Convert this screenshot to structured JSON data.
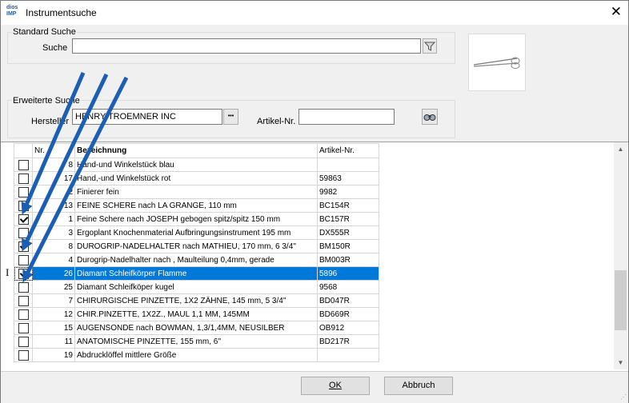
{
  "window": {
    "logo_top": "dios",
    "logo_bottom": "IMP",
    "title": "Instrumentsuche",
    "close_glyph": "✕"
  },
  "standard_search": {
    "legend": "Standard Suche",
    "label": "Suche",
    "value": "",
    "filter_icon": "filter-icon"
  },
  "extended_search": {
    "legend": "Erweiterte Suche",
    "hersteller_label": "Hersteller",
    "hersteller_value": "HENRY TROEMNER INC",
    "browse_label": "•••",
    "artikel_label": "Artikel-Nr.",
    "artikel_value": "",
    "search_icon": "binoculars-icon"
  },
  "table": {
    "columns": [
      "",
      "Nr.",
      "Bezeichnung",
      "Artikel-Nr."
    ],
    "rows": [
      {
        "checked": false,
        "nr": "8",
        "bezeichnung": "Hand-und Winkelstück blau",
        "artikel": "",
        "selected": false
      },
      {
        "checked": false,
        "nr": "17",
        "bezeichnung": "Hand,-und Winkelstück rot",
        "artikel": "59863",
        "selected": false
      },
      {
        "checked": false,
        "nr": "2",
        "bezeichnung": "Finierer fein",
        "artikel": "9982",
        "selected": false
      },
      {
        "checked": false,
        "nr": "13",
        "bezeichnung": "FEINE SCHERE nach LA GRANGE, 110 mm",
        "artikel": "BC154R",
        "selected": false
      },
      {
        "checked": true,
        "nr": "1",
        "bezeichnung": "Feine Schere nach JOSEPH gebogen spitz/spitz 150 mm",
        "artikel": "BC157R",
        "selected": false
      },
      {
        "checked": false,
        "nr": "3",
        "bezeichnung": "Ergoplant Knochenmaterial Aufbringungsinstrument 195 mm",
        "artikel": "DX555R",
        "selected": false
      },
      {
        "checked": true,
        "nr": "8",
        "bezeichnung": "DUROGRIP-NADELHALTER nach MATHIEU, 170 mm, 6 3/4''",
        "artikel": "BM150R",
        "selected": false
      },
      {
        "checked": false,
        "nr": "4",
        "bezeichnung": "Durogrip-Nadelhalter nach , Maulteilung 0,4mm, gerade",
        "artikel": "BM003R",
        "selected": false
      },
      {
        "checked": true,
        "nr": "26",
        "bezeichnung": "Diamant Schleifkörper Flamme",
        "artikel": "5896",
        "selected": true
      },
      {
        "checked": false,
        "nr": "25",
        "bezeichnung": "Diamant Schleifköper kugel",
        "artikel": "9568",
        "selected": false
      },
      {
        "checked": false,
        "nr": "7",
        "bezeichnung": "CHIRURGISCHE PINZETTE, 1X2 ZÄHNE, 145 mm, 5 3/4''",
        "artikel": "BD047R",
        "selected": false
      },
      {
        "checked": false,
        "nr": "12",
        "bezeichnung": "CHIR.PINZETTE, 1X2Z., MAUL 1,1 MM, 145MM",
        "artikel": "BD669R",
        "selected": false
      },
      {
        "checked": false,
        "nr": "15",
        "bezeichnung": "AUGENSONDE nach BOWMAN, 1,3/1,4MM, NEUSILBER",
        "artikel": "OB912",
        "selected": false
      },
      {
        "checked": false,
        "nr": "11",
        "bezeichnung": "ANATOMISCHE PINZETTE, 155 mm, 6''",
        "artikel": "BD217R",
        "selected": false
      },
      {
        "checked": false,
        "nr": "19",
        "bezeichnung": "Abdrucklöffel mittlere Größe",
        "artikel": "",
        "selected": false
      }
    ]
  },
  "buttons": {
    "ok": "OK",
    "cancel": "Abbruch"
  },
  "colors": {
    "selection": "#0078d7",
    "annotation_arrow": "#1a5fb4"
  }
}
